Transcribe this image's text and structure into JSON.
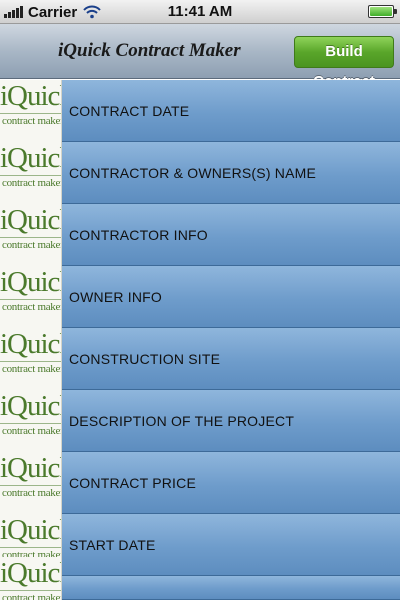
{
  "status_bar": {
    "carrier": "Carrier",
    "time": "11:41 AM",
    "icons": [
      "signal-bars-icon",
      "wifi-icon",
      "battery-icon"
    ],
    "battery_level": 1.0
  },
  "nav_bar": {
    "title": "iQuick Contract Maker",
    "build_button_label": "Build Contract",
    "build_button_color": "#5aa62a"
  },
  "list": {
    "thumb_logo_main": "iQuick",
    "thumb_logo_sub": "contract maker",
    "row_color": "#6e9ccb",
    "items": [
      {
        "label": "CONTRACT DATE"
      },
      {
        "label": "CONTRACTOR & OWNERS(S) NAME"
      },
      {
        "label": "CONTRACTOR INFO"
      },
      {
        "label": "OWNER  INFO"
      },
      {
        "label": "CONSTRUCTION SITE"
      },
      {
        "label": "DESCRIPTION OF THE PROJECT"
      },
      {
        "label": "CONTRACT PRICE"
      },
      {
        "label": "START DATE"
      }
    ]
  }
}
